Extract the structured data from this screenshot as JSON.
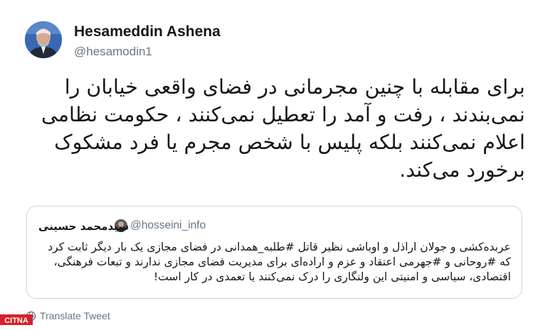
{
  "author": {
    "name": "Hesameddin Ashena",
    "handle": "@hesamodin1"
  },
  "tweet": {
    "text": "برای مقابله با چنین مجرمانی در فضای واقعی خیابان را نمی‌بندند ، رفت و آمد را تعطیل نمی‌کنند ، حکومت نظامی اعلام نمی‌کنند بلکه پلیس با شخص مجرم یا فرد مشکوک برخورد می‌کند."
  },
  "quoted_tweet": {
    "author_name": "سیدمحمد حسینی",
    "author_handle": "@hosseini_info",
    "text": "عربده‌کشی و جولان اراذل و اوباشی نظیر قاتل #طلبه_همدانی در فضای مجازی یک بار دیگر ثابت کرد که #روحانی و #جهرمی اعتقاد و عزم و اراده‌ای برای مدیریت فضای مجازی ندارند و تبعات فرهنگی، اقتصادی، سیاسی و امنیتی این ولنگاری را درک نمی‌کنند یا تعمدی در کار است!"
  },
  "actions": {
    "translate_label": "Translate Tweet"
  },
  "watermark": {
    "brand": "CITNA"
  },
  "icons": {
    "translate": "globe-icon"
  },
  "colors": {
    "text": "#14171a",
    "secondary": "#657786",
    "border": "#ccd6dd",
    "watermark": "#d6212a"
  }
}
